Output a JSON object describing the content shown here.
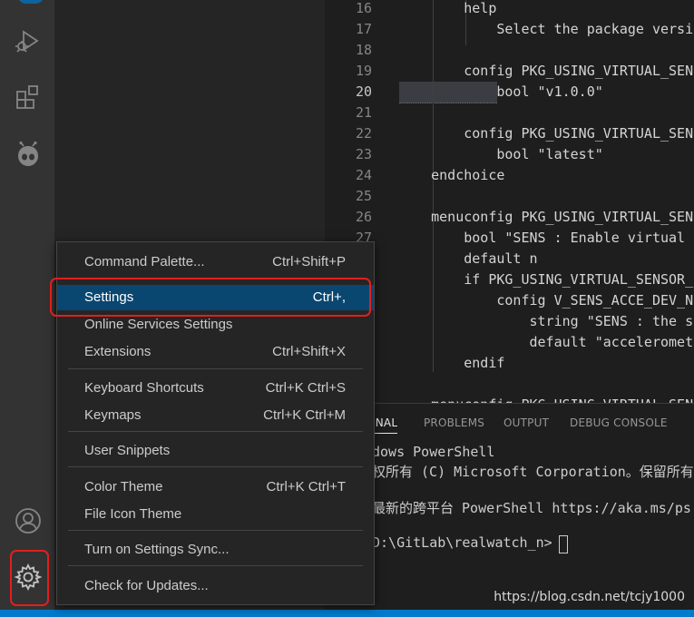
{
  "activity_bar": {
    "icons": [
      "run-debug-icon",
      "extensions-icon",
      "platformio-icon",
      "account-icon",
      "manage-gear-icon"
    ]
  },
  "editor": {
    "lines": [
      {
        "num": "16",
        "text": "        help"
      },
      {
        "num": "17",
        "text": "            Select the package versi"
      },
      {
        "num": "18",
        "text": ""
      },
      {
        "num": "19",
        "text": "        config PKG_USING_VIRTUAL_SEN"
      },
      {
        "num": "20",
        "text": "            bool \"v1.0.0\""
      },
      {
        "num": "21",
        "text": ""
      },
      {
        "num": "22",
        "text": "        config PKG_USING_VIRTUAL_SEN"
      },
      {
        "num": "23",
        "text": "            bool \"latest\""
      },
      {
        "num": "24",
        "text": "    endchoice"
      },
      {
        "num": "25",
        "text": ""
      },
      {
        "num": "26",
        "text": "    menuconfig PKG_USING_VIRTUAL_SEN"
      },
      {
        "num": "27",
        "text": "        bool \"SENS : Enable virtual"
      },
      {
        "num": "",
        "text": "        default n"
      },
      {
        "num": "",
        "text": "        if PKG_USING_VIRTUAL_SENSOR_"
      },
      {
        "num": "",
        "text": "            config V_SENS_ACCE_DEV_N"
      },
      {
        "num": "",
        "text": "                string \"SENS : the s"
      },
      {
        "num": "",
        "text": "                default \"acceleromet"
      },
      {
        "num": "",
        "text": "        endif"
      },
      {
        "num": "",
        "text": ""
      },
      {
        "num": "",
        "text": "    menuconfig PKG_USING_VIRTUAL_SEN"
      }
    ],
    "active_line": "20"
  },
  "panel": {
    "tabs": [
      "INAL",
      "PROBLEMS",
      "OUTPUT",
      "DEBUG CONSOLE"
    ],
    "active_tab": "INAL",
    "terminal_lines": [
      "dows PowerShell",
      "权所有 (C) Microsoft Corporation。保留所有",
      "",
      "最新的跨平台 PowerShell https://aka.ms/ps",
      "",
      "D:\\GitLab\\realwatch_n> "
    ]
  },
  "menu": {
    "items": [
      {
        "label": "Command Palette...",
        "shortcut": "Ctrl+Shift+P"
      },
      {
        "label": "Settings",
        "shortcut": "Ctrl+,"
      },
      {
        "label": "Online Services Settings",
        "shortcut": ""
      },
      {
        "label": "Extensions",
        "shortcut": "Ctrl+Shift+X"
      },
      {
        "label": "Keyboard Shortcuts",
        "shortcut": "Ctrl+K Ctrl+S"
      },
      {
        "label": "Keymaps",
        "shortcut": "Ctrl+K Ctrl+M"
      },
      {
        "label": "User Snippets",
        "shortcut": ""
      },
      {
        "label": "Color Theme",
        "shortcut": "Ctrl+K Ctrl+T"
      },
      {
        "label": "File Icon Theme",
        "shortcut": ""
      },
      {
        "label": "Turn on Settings Sync...",
        "shortcut": ""
      },
      {
        "label": "Check for Updates...",
        "shortcut": ""
      }
    ],
    "selected": "Settings"
  },
  "watermark": "https://blog.csdn.net/tcjy1000",
  "colors": {
    "accent": "#007acc",
    "selection": "#094771",
    "highlight_box": "#e21e1e"
  }
}
